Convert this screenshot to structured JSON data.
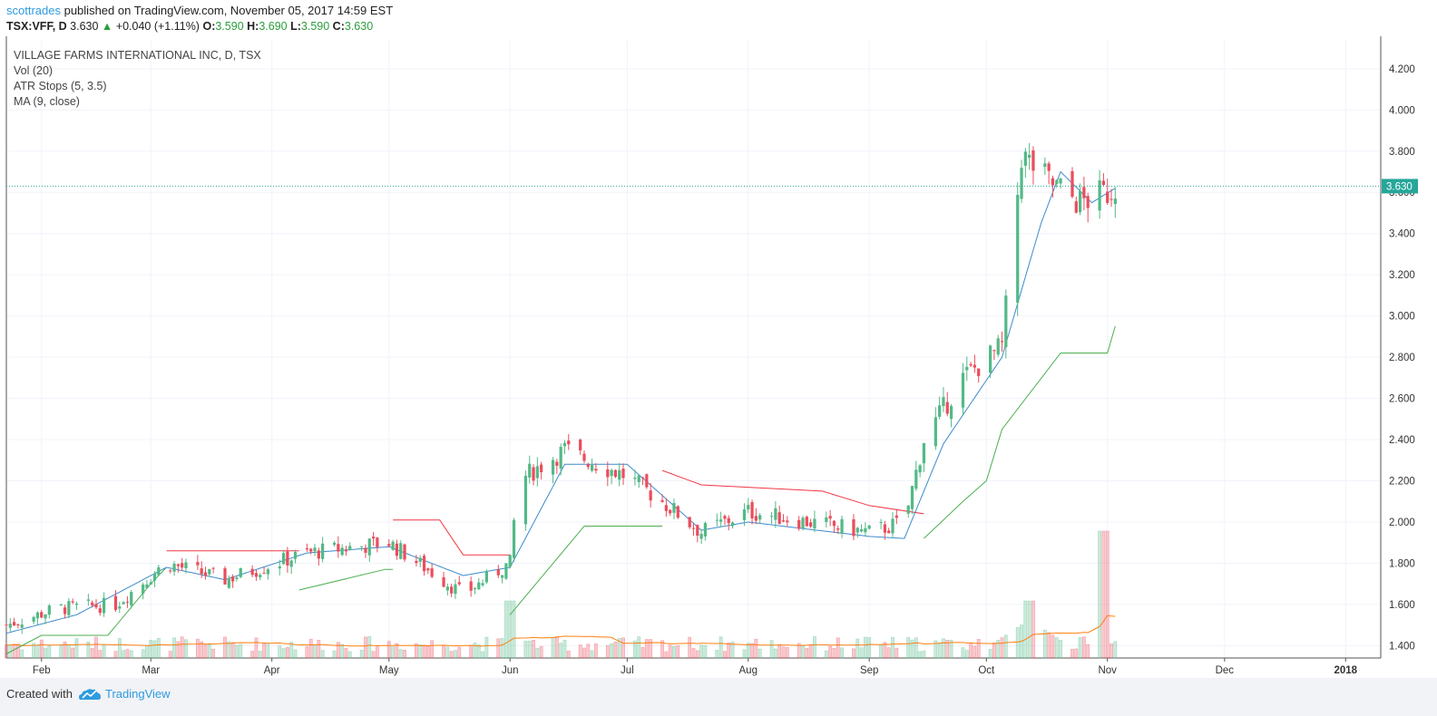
{
  "header": {
    "author": "scottrades",
    "published": " published on TradingView.com, November 05, 2017 14:59 EST",
    "symbol": "TSX:VFF, D",
    "price": "3.630",
    "change": "+0.040 (+1.11%)",
    "o_label": "O:",
    "o_val": "3.590",
    "h_label": "H:",
    "h_val": "3.690",
    "l_label": "L:",
    "l_val": "3.590",
    "c_label": "C:",
    "c_val": "3.630"
  },
  "legend": {
    "title": "VILLAGE FARMS INTERNATIONAL INC, D, TSX",
    "vol": "Vol (20)",
    "atr": "ATR Stops (5, 3.5)",
    "ma": "MA (9, close)"
  },
  "footer": {
    "created": "Created with",
    "brand": "TradingView"
  },
  "chart_data": {
    "type": "candlestick",
    "title": "VILLAGE FARMS INTERNATIONAL INC, D, TSX",
    "ylim": [
      1.34,
      4.34
    ],
    "y_ticks": [
      "4.200",
      "4.000",
      "3.800",
      "3.600",
      "3.400",
      "3.200",
      "3.000",
      "2.800",
      "2.600",
      "2.400",
      "2.200",
      "2.000",
      "1.800",
      "1.600",
      "1.400"
    ],
    "y_tick_values": [
      4.2,
      4.0,
      3.8,
      3.6,
      3.4,
      3.2,
      3.0,
      2.8,
      2.6,
      2.4,
      2.2,
      2.0,
      1.8,
      1.6,
      1.4
    ],
    "x_tick_labels": [
      "Feb",
      "Mar",
      "Apr",
      "May",
      "Jun",
      "Jul",
      "Aug",
      "Sep",
      "Oct",
      "Nov",
      "Dec",
      "2018"
    ],
    "x_tick_dates": [
      "2017-02-01",
      "2017-03-01",
      "2017-04-01",
      "2017-05-01",
      "2017-06-01",
      "2017-07-01",
      "2017-08-01",
      "2017-09-01",
      "2017-10-01",
      "2017-11-01",
      "2017-12-01",
      "2018-01-01"
    ],
    "date_range": [
      "2017-01-23",
      "2018-01-10"
    ],
    "last_price": "3.630",
    "last_value": 3.63,
    "colors": {
      "up": "#53b987",
      "down": "#eb4d5c",
      "ma": "#3d8bcd",
      "atr_up": "#4caf50",
      "atr_down": "#f23645",
      "vol_ma": "#ff7f0e",
      "price_line": "#26a69a"
    },
    "series": [
      {
        "name": "VFF",
        "anchors_date": [
          "2017-01-23",
          "2017-02-05",
          "2017-02-20",
          "2017-03-05",
          "2017-03-20",
          "2017-04-10",
          "2017-05-01",
          "2017-05-20",
          "2017-06-01",
          "2017-06-03",
          "2017-06-15",
          "2017-07-01",
          "2017-07-10",
          "2017-07-20",
          "2017-08-01",
          "2017-09-01",
          "2017-09-10",
          "2017-09-15",
          "2017-09-25",
          "2017-10-05",
          "2017-10-10",
          "2017-10-17",
          "2017-10-25",
          "2017-11-01",
          "2017-11-03"
        ],
        "anchors_close": [
          1.5,
          1.58,
          1.6,
          1.8,
          1.72,
          1.85,
          1.9,
          1.65,
          1.8,
          2.2,
          2.35,
          2.22,
          2.1,
          1.95,
          2.05,
          1.95,
          2.0,
          2.4,
          2.7,
          2.85,
          3.78,
          3.65,
          3.55,
          3.6,
          3.63
        ]
      },
      {
        "name": "MA (9, close)",
        "anchors_date": [
          "2017-01-23",
          "2017-02-10",
          "2017-03-05",
          "2017-03-20",
          "2017-04-10",
          "2017-05-01",
          "2017-05-20",
          "2017-06-01",
          "2017-06-15",
          "2017-07-01",
          "2017-07-20",
          "2017-08-01",
          "2017-09-01",
          "2017-09-10",
          "2017-09-20",
          "2017-10-05",
          "2017-10-15",
          "2017-10-20",
          "2017-10-28",
          "2017-11-03"
        ],
        "anchors_value": [
          1.46,
          1.55,
          1.78,
          1.72,
          1.85,
          1.88,
          1.74,
          1.78,
          2.28,
          2.28,
          1.96,
          2.0,
          1.93,
          1.92,
          2.38,
          2.8,
          3.45,
          3.7,
          3.55,
          3.62
        ]
      },
      {
        "name": "ATR Stops (5, 3.5)",
        "segments": [
          {
            "dir": "up",
            "dates": [
              "2017-01-23",
              "2017-02-01",
              "2017-02-18",
              "2017-03-01",
              "2017-03-05"
            ],
            "values": [
              1.36,
              1.45,
              1.45,
              1.7,
              1.78
            ]
          },
          {
            "dir": "down",
            "dates": [
              "2017-03-05",
              "2017-03-24",
              "2017-04-08"
            ],
            "values": [
              1.86,
              1.86,
              1.86
            ]
          },
          {
            "dir": "up",
            "dates": [
              "2017-04-08",
              "2017-04-30",
              "2017-05-02"
            ],
            "values": [
              1.67,
              1.77,
              1.77
            ]
          },
          {
            "dir": "down",
            "dates": [
              "2017-05-02",
              "2017-05-14",
              "2017-05-20",
              "2017-06-01"
            ],
            "values": [
              2.01,
              2.01,
              1.84,
              1.84
            ]
          },
          {
            "dir": "up",
            "dates": [
              "2017-06-01",
              "2017-06-20",
              "2017-07-10"
            ],
            "values": [
              1.55,
              1.98,
              1.98
            ]
          },
          {
            "dir": "down",
            "dates": [
              "2017-07-10",
              "2017-07-20",
              "2017-08-20",
              "2017-09-01",
              "2017-09-15"
            ],
            "values": [
              2.25,
              2.18,
              2.15,
              2.08,
              2.04
            ]
          },
          {
            "dir": "up",
            "dates": [
              "2017-09-15",
              "2017-09-25",
              "2017-10-01",
              "2017-10-05",
              "2017-10-20",
              "2017-11-01",
              "2017-11-03"
            ],
            "values": [
              1.92,
              2.1,
              2.2,
              2.45,
              2.82,
              2.82,
              2.95
            ]
          }
        ]
      },
      {
        "name": "Vol (20)",
        "volume_ratio_peak": 1.0,
        "notable_spikes_date": [
          "2017-06-01",
          "2017-10-12",
          "2017-10-31"
        ]
      }
    ]
  }
}
